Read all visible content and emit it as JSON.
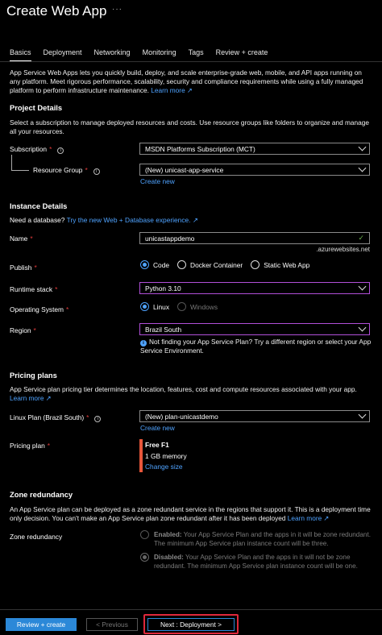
{
  "header": {
    "title": "Create Web App",
    "more": "···"
  },
  "tabs": [
    {
      "label": "Basics",
      "active": true
    },
    {
      "label": "Deployment"
    },
    {
      "label": "Networking"
    },
    {
      "label": "Monitoring"
    },
    {
      "label": "Tags"
    },
    {
      "label": "Review + create"
    }
  ],
  "intro": {
    "text": "App Service Web Apps lets you quickly build, deploy, and scale enterprise-grade web, mobile, and API apps running on any platform. Meet rigorous performance, scalability, security and compliance requirements while using a fully managed platform to perform infrastructure maintenance.",
    "learn_more": "Learn more"
  },
  "project": {
    "heading": "Project Details",
    "desc": "Select a subscription to manage deployed resources and costs. Use resource groups like folders to organize and manage all your resources.",
    "subscription_label": "Subscription",
    "subscription_value": "MSDN Platforms Subscription (MCT)",
    "rg_label": "Resource Group",
    "rg_value": "(New) unicast-app-service",
    "create_new": "Create new"
  },
  "instance": {
    "heading": "Instance Details",
    "need_db": "Need a database?",
    "try_link": "Try the new Web + Database experience.",
    "name_label": "Name",
    "name_value": "unicastappdemo",
    "name_suffix": ".azurewebsites.net",
    "publish_label": "Publish",
    "publish_options": [
      "Code",
      "Docker Container",
      "Static Web App"
    ],
    "runtime_label": "Runtime stack",
    "runtime_value": "Python 3.10",
    "os_label": "Operating System",
    "os_options": [
      "Linux",
      "Windows"
    ],
    "region_label": "Region",
    "region_value": "Brazil South",
    "region_note": "Not finding your App Service Plan? Try a different region or select your App Service Environment."
  },
  "pricing": {
    "heading": "Pricing plans",
    "desc": "App Service plan pricing tier determines the location, features, cost and compute resources associated with your app.",
    "learn_more": "Learn more",
    "linux_plan_label": "Linux Plan (Brazil South)",
    "linux_plan_value": "(New) plan-unicastdemo",
    "create_new": "Create new",
    "plan_label": "Pricing plan",
    "plan_name": "Free F1",
    "plan_memory": "1 GB memory",
    "change_size": "Change size"
  },
  "zone": {
    "heading": "Zone redundancy",
    "desc": "An App Service plan can be deployed as a zone redundant service in the regions that support it. This is a deployment time only decision. You can't make an App Service plan zone redundant after it has been deployed",
    "learn_more": "Learn more",
    "label": "Zone redundancy",
    "enabled_title": "Enabled:",
    "enabled_text": "Your App Service Plan and the apps in it will be zone redundant. The minimum App Service plan instance count will be three.",
    "disabled_title": "Disabled:",
    "disabled_text": "Your App Service Plan and the apps in it will not be zone redundant. The minimum App Service plan instance count will be one."
  },
  "footer": {
    "review": "Review + create",
    "previous": "< Previous",
    "next": "Next : Deployment >"
  },
  "colors": {
    "accent": "#2b88d8",
    "link": "#4fa3ff",
    "required": "#e23b3b",
    "focus": "#b14fd8",
    "highlight": "#e0283c"
  }
}
